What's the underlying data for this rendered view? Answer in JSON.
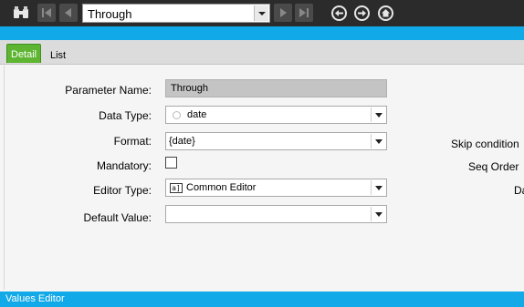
{
  "toolbar": {
    "selected_parameter": "Through",
    "icons": [
      "binoculars-icon",
      "first-record-icon",
      "previous-record-icon",
      "next-record-icon",
      "last-record-icon",
      "back-icon",
      "forward-icon",
      "home-icon"
    ]
  },
  "tabs": [
    {
      "label": "Detail",
      "active": true
    },
    {
      "label": "List",
      "active": false
    }
  ],
  "form": {
    "parameter_name": {
      "label": "Parameter Name:",
      "value": "Through"
    },
    "data_type": {
      "label": "Data Type:",
      "value": "date"
    },
    "format": {
      "label": "Format:",
      "value": "{date}"
    },
    "mandatory": {
      "label": "Mandatory:",
      "checked": false
    },
    "editor_type": {
      "label": "Editor Type:",
      "value": "Common Editor"
    },
    "default_value": {
      "label": "Default Value:",
      "value": ""
    }
  },
  "right_labels": {
    "skip_condition": "Skip condition",
    "seq_order": "Seq Order",
    "da": "Da"
  },
  "bottom_bar": {
    "title": "Values Editor"
  },
  "colors": {
    "accent_blue": "#11a9e8",
    "active_tab_green": "#5db531",
    "toolbar_bg": "#2b2b2b"
  }
}
